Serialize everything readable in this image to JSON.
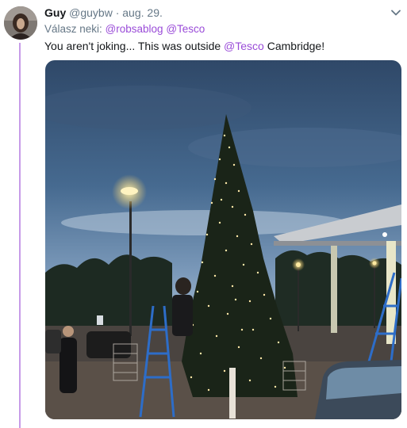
{
  "tweet": {
    "author_name": "Guy",
    "author_handle": "@guybw",
    "separator": "·",
    "date": "aug. 29.",
    "reply_prefix": "Válasz neki:",
    "reply_mentions": [
      "@robsablog",
      "@Tesco"
    ],
    "text_before": "You aren't joking... This was outside",
    "text_mention": "@Tesco",
    "text_after": "Cambridge!"
  },
  "icons": {
    "menu": "chevron-down-icon"
  },
  "colors": {
    "accent": "#9a4cd8",
    "thread_line": "#c79be8",
    "secondary_text": "#657786",
    "primary_text": "#14171a"
  }
}
